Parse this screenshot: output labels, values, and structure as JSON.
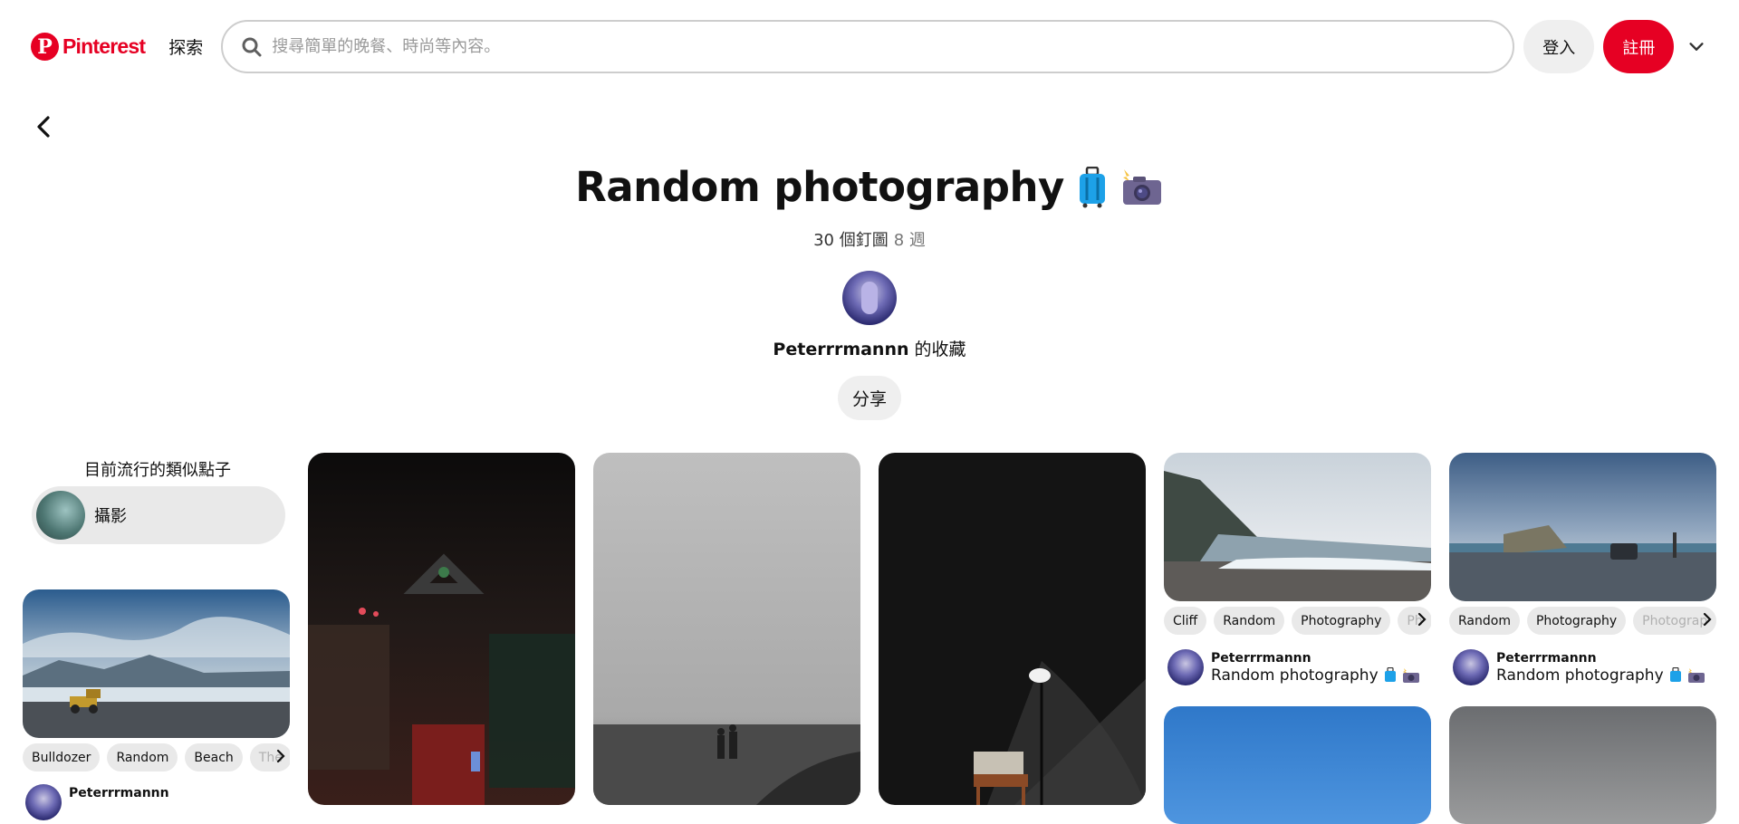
{
  "header": {
    "brand": "Pinterest",
    "explore_label": "探索",
    "search_placeholder": "搜尋簡單的晚餐、時尚等內容。",
    "login_label": "登入",
    "signup_label": "註冊"
  },
  "board": {
    "title": "Random photography",
    "title_icons": [
      "luggage-icon",
      "camera-flash-icon"
    ],
    "pin_count": "30 個釘圖",
    "age": "8 週",
    "owner_name": "Peterrrmannn",
    "owner_suffix": " 的收藏",
    "share_label": "分享"
  },
  "sidebar": {
    "title": "目前流行的類似點子",
    "idea_label": "攝影"
  },
  "pins": [
    {
      "tags": [
        "Bulldozer",
        "Random",
        "Beach",
        "The"
      ],
      "user": "Peterrrmannn"
    },
    {
      "tags": [
        "Cliff",
        "Random",
        "Photography",
        "Ph"
      ],
      "user": "Peterrrmannn",
      "board": "Random photography"
    },
    {
      "tags": [
        "Random",
        "Photography",
        "Photograp"
      ],
      "user": "Peterrrmannn",
      "board": "Random photography"
    }
  ],
  "colors": {
    "brand": "#e60023",
    "chip": "#e9e9e9"
  }
}
